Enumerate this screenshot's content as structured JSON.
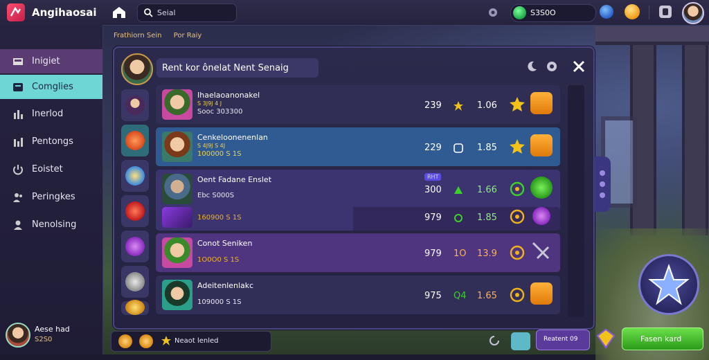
{
  "app": {
    "title": "Angihaosai"
  },
  "search": {
    "value": "Seial"
  },
  "currency": {
    "value": "S3S0O"
  },
  "breadcrumb": [
    "Frathiorn Sein",
    "Por Raiy"
  ],
  "sidebar": {
    "items": [
      {
        "label": "Inigiet",
        "icon": "inbox-icon"
      },
      {
        "label": "Comglies",
        "icon": "tag-icon"
      },
      {
        "label": "Inerlod",
        "icon": "stats-icon"
      },
      {
        "label": "Pentongs",
        "icon": "bar-chart-icon"
      },
      {
        "label": "Eoistet",
        "icon": "power-icon"
      },
      {
        "label": "Peringkes",
        "icon": "users-icon"
      },
      {
        "label": "Nenolsing",
        "icon": "user-icon"
      }
    ],
    "user": {
      "name": "Aese had",
      "sub": "S2S0"
    }
  },
  "panel": {
    "title": "Rent kor ônelat Nent Senaig"
  },
  "rows": [
    {
      "name": "Ihaelaoanonakel",
      "sub": "S 3J9J 4 J",
      "meta": "Sooc 303300 ",
      "tag": "",
      "v1": "239",
      "v2": "1.06",
      "colors": {
        "v2": "#ffffff"
      }
    },
    {
      "name": "Cenkeloonenenlan",
      "sub": "S 4J9J S 4J",
      "meta": "100000 S 1S",
      "tag": "",
      "v1": "229",
      "v2": "1.85",
      "colors": {
        "v2": "#ffffff"
      }
    },
    {
      "name": "Oent Fadane Enslet",
      "sub": "",
      "meta": "Ebc S000S ",
      "tag": "RHT",
      "v1": "300",
      "v2": "1.66",
      "colors": {
        "v2": "#8af07a"
      }
    },
    {
      "name": "",
      "sub": "",
      "meta": "160900 S 1S",
      "tag": "",
      "v1": "979",
      "v2": "1.85",
      "colors": {
        "v2": "#8af07a"
      }
    },
    {
      "name": "Conot Seniken",
      "sub": "",
      "meta": "1O0O0 S 1S",
      "tag": "",
      "v1": "979",
      "v2": "13.9",
      "colors": {
        "v2": "#ffb347"
      }
    },
    {
      "name": "Adeitenlenlakc",
      "sub": "",
      "meta": "109000 S 1S",
      "tag": "",
      "v1": "975",
      "v2": "1.65",
      "colors": {
        "v2": "#ffb347"
      }
    }
  ],
  "row_extra": [
    "1O",
    "Q4"
  ],
  "bottom": {
    "text": "Neaot lenled"
  },
  "buttons": {
    "purple": "Reatent 09",
    "green": "Fasen kard"
  },
  "colors": {
    "accent": "#6fd6d6",
    "primary": "#5b3c72",
    "green": "#3fcf2a",
    "gold": "#f0b31a"
  }
}
